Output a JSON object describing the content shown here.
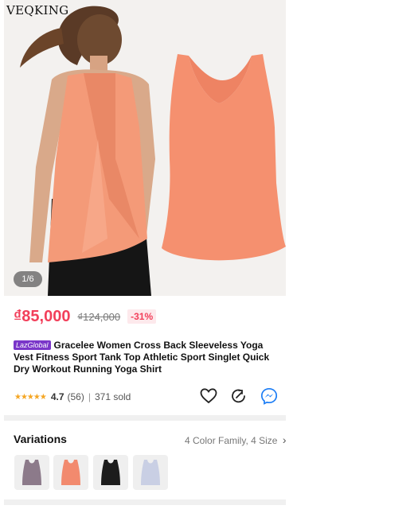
{
  "brand": "VEQKING",
  "image_counter": "1/6",
  "price": {
    "current": "₫85,000",
    "original": "₫124,000",
    "discount": "-31%"
  },
  "product": {
    "badge": "LazGlobal",
    "title": "Gracelee Women Cross Back Sleeveless Yoga Vest Fitness Sport Tank Top Athletic Sport Singlet Quick Dry Workout Running Yoga Shirt"
  },
  "rating": {
    "stars": "★★★★★",
    "value": "4.7",
    "count": "(56)",
    "separator": "|",
    "sold": "371 sold"
  },
  "actions": {
    "wishlist_icon": "heart-icon",
    "share_icon": "share-icon",
    "messenger_icon": "messenger-icon"
  },
  "variations": {
    "title": "Variations",
    "summary": "4 Color Family, 4 Size",
    "chevron": "›",
    "swatches": [
      {
        "color": "#8c7a8a",
        "name": "mauve"
      },
      {
        "color": "#f28a6e",
        "name": "coral"
      },
      {
        "color": "#1c1c1c",
        "name": "black"
      },
      {
        "color": "#c9cfe4",
        "name": "lavender"
      }
    ]
  },
  "colors": {
    "accent": "#f23f5a",
    "tank": "#f5906f",
    "badge": "#7a36c9",
    "star": "#f5a623",
    "messenger": "#1a7cf5"
  }
}
